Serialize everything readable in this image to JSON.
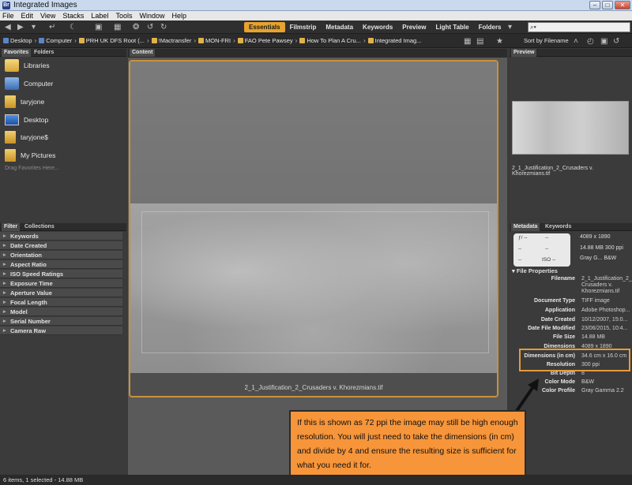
{
  "window": {
    "title": "Integrated Images"
  },
  "menu": [
    "File",
    "Edit",
    "View",
    "Stacks",
    "Label",
    "Tools",
    "Window",
    "Help"
  ],
  "workspaces": [
    "Essentials",
    "Filmstrip",
    "Metadata",
    "Keywords",
    "Preview",
    "Light Table",
    "Folders"
  ],
  "search": {
    "placeholder": "⌕▾"
  },
  "breadcrumbs": [
    "Desktop",
    "Computer",
    "PRH UK DFS Root (...",
    "!Mactransfer",
    "MON-FRI",
    "FAO Pete Pawsey",
    "How To Plan A Cru...",
    "Integrated Imag..."
  ],
  "sort": {
    "label": "Sort by Filename"
  },
  "favorites": {
    "tabs": [
      "Favorites",
      "Folders"
    ],
    "items": [
      "Libraries",
      "Computer",
      "taryjone",
      "Desktop",
      "taryjone$",
      "My Pictures"
    ],
    "hint": "Drag Favorites Here..."
  },
  "filter": {
    "tabs": [
      "Filter",
      "Collections"
    ],
    "rows": [
      "Keywords",
      "Date Created",
      "Orientation",
      "Aspect Ratio",
      "ISO Speed Ratings",
      "Exposure Time",
      "Aperture Value",
      "Focal Length",
      "Model",
      "Serial Number",
      "Camera Raw"
    ]
  },
  "content": {
    "tab": "Content",
    "caption": "2_1_Justification_2_Crusaders v. Khorezmians.tif"
  },
  "preview": {
    "tab": "Preview",
    "caption": "2_1_Justification_2_Crusaders v. Khorezmians.tif"
  },
  "metadata": {
    "tabs": [
      "Metadata",
      "Keywords"
    ],
    "summary": {
      "fstop": "ƒ/ --",
      "dash1": "--",
      "dash2": "--",
      "dash3": "--",
      "dash4": "--",
      "iso": "ISO --",
      "dims": "4089 x 1890",
      "size": "14.88 MB  300 ppi",
      "color": "Gray G...  B&W"
    },
    "section": "File Properties",
    "properties": [
      {
        "key": "Filename",
        "value": "2_1_Justification_2_"
      },
      {
        "key": "",
        "value": "Crusaders v."
      },
      {
        "key": "",
        "value": "Khorezmians.tif"
      },
      {
        "key": "Document Type",
        "value": "TIFF image"
      },
      {
        "key": "Application",
        "value": "Adobe Photoshop..."
      },
      {
        "key": "Date Created",
        "value": "10/12/2007, 15:0..."
      },
      {
        "key": "Date File Modified",
        "value": "23/06/2015, 10:4..."
      },
      {
        "key": "File Size",
        "value": "14.88 MB"
      },
      {
        "key": "Dimensions",
        "value": "4089 x 1890"
      },
      {
        "key": "Dimensions (in cm)",
        "value": "34.6 cm x 16.0 cm"
      },
      {
        "key": "Resolution",
        "value": "300 ppi"
      },
      {
        "key": "Bit Depth",
        "value": "8"
      },
      {
        "key": "Color Mode",
        "value": "B&W"
      },
      {
        "key": "Color Profile",
        "value": "Gray Gamma 2.2"
      }
    ]
  },
  "annotation": {
    "text": "If this is shown as 72 ppi the image may still be high enough resolution. You will just need to take the dimensions (in cm) and divide by 4 and ensure the resulting size is sufficient for what you need it for."
  },
  "status": {
    "text": "6 items, 1 selected - 14.88 MB"
  },
  "colors": {
    "accent": "#e7a32e",
    "highlight": "#e69b3a",
    "note_bg": "#f7953a"
  }
}
